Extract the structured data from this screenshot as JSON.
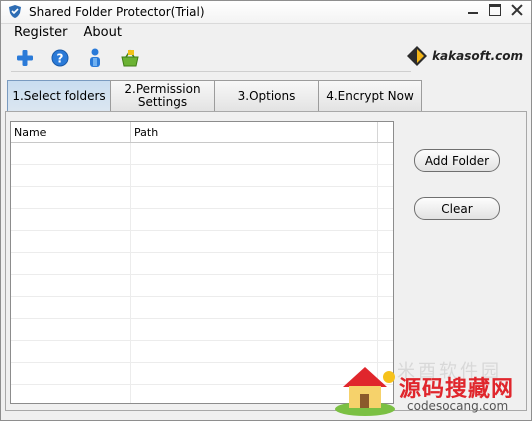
{
  "window": {
    "title": "Shared Folder Protector(Trial)"
  },
  "menu": {
    "items": [
      "Register",
      "About"
    ]
  },
  "toolbar": {
    "icons": [
      "add-icon",
      "help-icon",
      "user-icon",
      "shop-basket-icon"
    ]
  },
  "brand": {
    "name": "kakasoft.com"
  },
  "tabs": [
    {
      "label": "1.Select folders",
      "active": true
    },
    {
      "label": "2.Permission\nSettings",
      "active": false
    },
    {
      "label": "3.Options",
      "active": false
    },
    {
      "label": "4.Encrypt Now",
      "active": false
    }
  ],
  "folder_list": {
    "columns": [
      "Name",
      "Path"
    ],
    "rows": []
  },
  "buttons": {
    "add_folder": "Add Folder",
    "clear": "Clear"
  },
  "watermark": {
    "faded_text": "米酉软件园",
    "main_text": "源码搜藏网",
    "url": "codesocang.com"
  },
  "colors": {
    "accent_blue": "#2a7ad8",
    "watermark_red": "#e0262c"
  }
}
